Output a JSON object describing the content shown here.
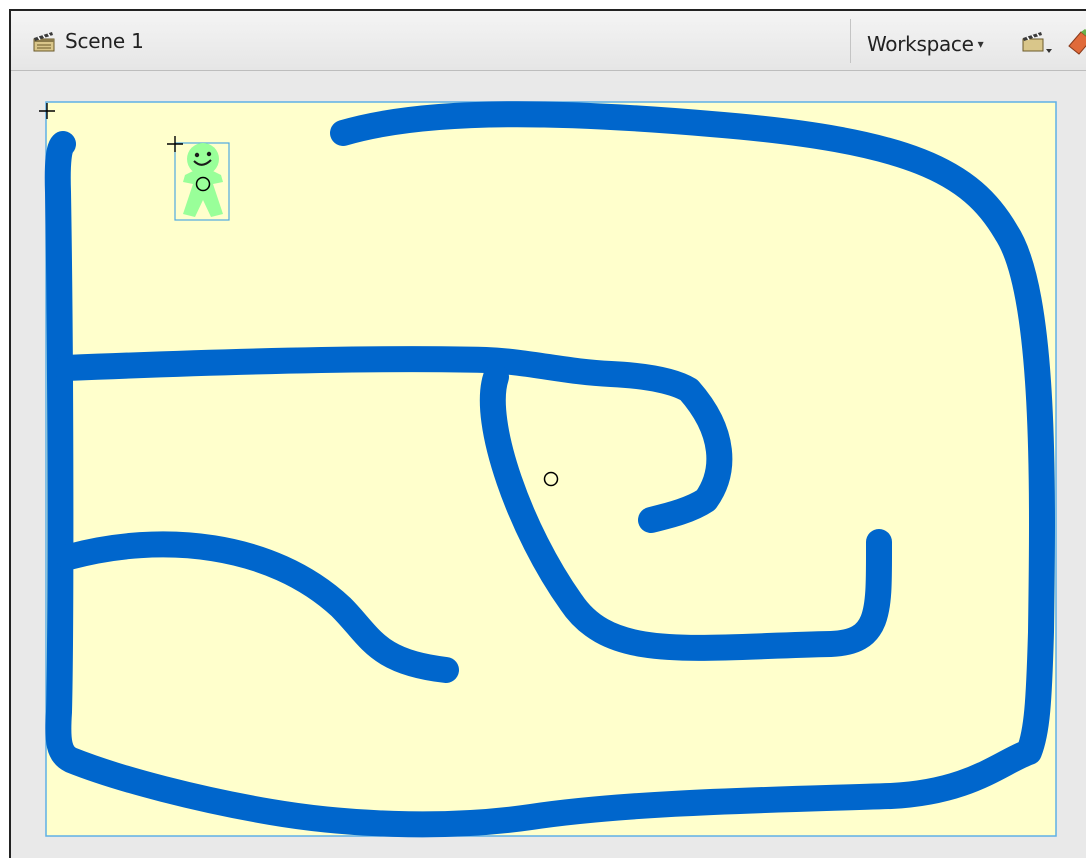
{
  "header": {
    "scene_label": "Scene 1",
    "workspace_label": "Workspace",
    "workspace_arrow": "▾"
  },
  "icons": {
    "scene": "clapperboard-icon",
    "edit_scene": "clapperboard-dropdown-icon",
    "edit_symbol": "symbol-edit-icon"
  },
  "colors": {
    "stage_background": "#ffffcc",
    "stroke": "#0066cc",
    "character": "#99ff99",
    "selection": "#4fa9e0"
  }
}
